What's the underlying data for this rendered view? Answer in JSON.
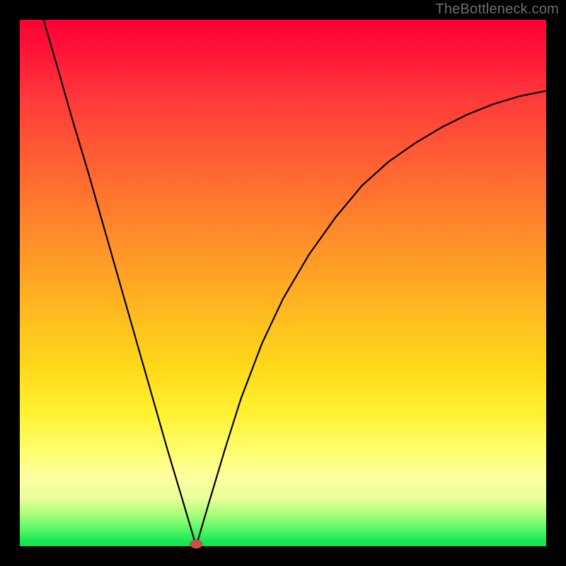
{
  "watermark": "TheBottleneck.com",
  "chart_data": {
    "type": "line",
    "title": "",
    "xlabel": "",
    "ylabel": "",
    "xlim": [
      0,
      1
    ],
    "ylim": [
      0,
      1
    ],
    "grid": false,
    "legend": false,
    "background_gradient": {
      "top": "#ff0033",
      "mid": "#ffd91a",
      "bottom": "#10e454"
    },
    "min_marker": {
      "x": 0.335,
      "y": 0.0,
      "color": "#c9504f"
    },
    "series": [
      {
        "name": "curve",
        "color": "#000000",
        "x": [
          0.045,
          0.07,
          0.1,
          0.13,
          0.16,
          0.19,
          0.22,
          0.25,
          0.28,
          0.31,
          0.335,
          0.36,
          0.39,
          0.42,
          0.46,
          0.5,
          0.55,
          0.6,
          0.65,
          0.7,
          0.75,
          0.8,
          0.85,
          0.9,
          0.95,
          1.0
        ],
        "y": [
          1.0,
          0.915,
          0.81,
          0.71,
          0.605,
          0.5,
          0.395,
          0.29,
          0.185,
          0.085,
          0.0,
          0.085,
          0.185,
          0.28,
          0.385,
          0.47,
          0.555,
          0.625,
          0.685,
          0.73,
          0.765,
          0.795,
          0.82,
          0.84,
          0.855,
          0.865
        ]
      }
    ]
  }
}
